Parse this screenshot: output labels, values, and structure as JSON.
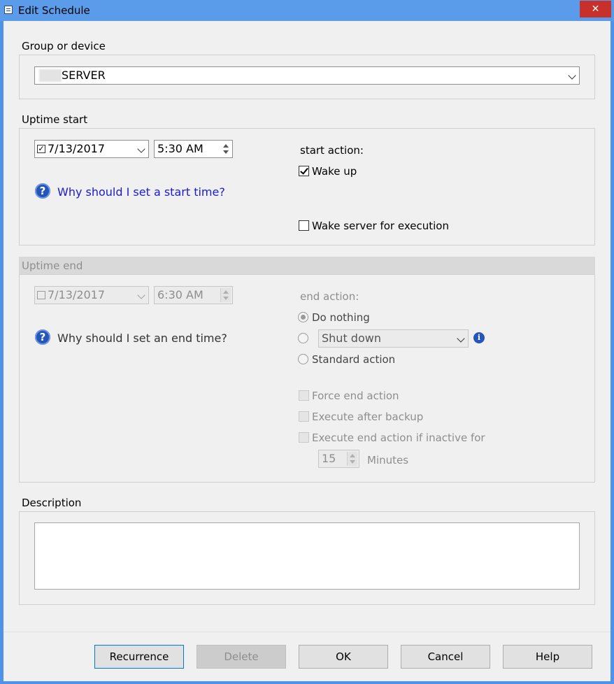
{
  "window": {
    "title": "Edit Schedule",
    "close_glyph": "✕"
  },
  "device": {
    "section_label": "Group or device",
    "selected_value": "SERVER"
  },
  "uptime_start": {
    "section_label": "Uptime start",
    "date": "7/13/2017",
    "time": "5:30 AM",
    "action_label": "start action:",
    "wake_up_label": "Wake up",
    "wake_server_label": "Wake server for execution",
    "help_link": "Why should I set a start time?"
  },
  "uptime_end": {
    "section_label": "Uptime end",
    "date": "7/13/2017",
    "time": "6:30 AM",
    "action_label": "end action:",
    "do_nothing_label": "Do nothing",
    "shutdown_value": "Shut down",
    "standard_action_label": "Standard action",
    "force_end_label": "Force end action",
    "execute_after_backup_label": "Execute after backup",
    "execute_inactive_label": "Execute end action if inactive for",
    "minutes_value": "15",
    "minutes_label": "Minutes",
    "help_text": "Why should I set an end time?"
  },
  "description": {
    "section_label": "Description",
    "value": ""
  },
  "buttons": {
    "recurrence": "Recurrence",
    "delete": "Delete",
    "ok": "OK",
    "cancel": "Cancel",
    "help": "Help"
  },
  "icons": {
    "help": "?",
    "info": "i",
    "check": "✓"
  },
  "colors": {
    "window_border": "#4f93e8",
    "link": "#1a1ad2",
    "help_icon": "#2356b8",
    "close_button": "#c7302b"
  }
}
